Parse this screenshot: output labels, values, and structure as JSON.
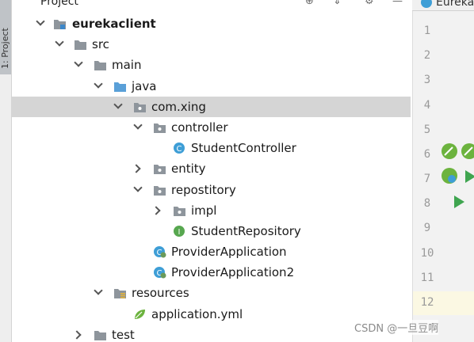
{
  "tool_strip": {
    "label": "1: Project"
  },
  "panel": {
    "title": "Project"
  },
  "tree": {
    "eurekaclient": "eurekaclient",
    "src": "src",
    "main": "main",
    "java": "java",
    "comxing": "com.xing",
    "controller": "controller",
    "student_controller": "StudentController",
    "entity": "entity",
    "repostitory": "repostitory",
    "impl": "impl",
    "student_repository": "StudentRepository",
    "provider_application": "ProviderApplication",
    "provider_application2": "ProviderApplication2",
    "resources": "resources",
    "application_yml": "application.yml",
    "test": "test"
  },
  "editor": {
    "tab_label": "Eureka",
    "line_numbers": [
      "1",
      "2",
      "3",
      "4",
      "5",
      "6",
      "7",
      "8",
      "9",
      "10",
      "11",
      "12"
    ]
  },
  "watermark": "CSDN @一旦豆啊",
  "colors": {
    "selected_row": "#d5d5d5",
    "folder_gray": "#8e959c",
    "source_folder_blue": "#5aa0d8",
    "class_icon_blue": "#3e9ed6",
    "interface_icon_green": "#57a74f",
    "run_green": "#3fa550"
  }
}
